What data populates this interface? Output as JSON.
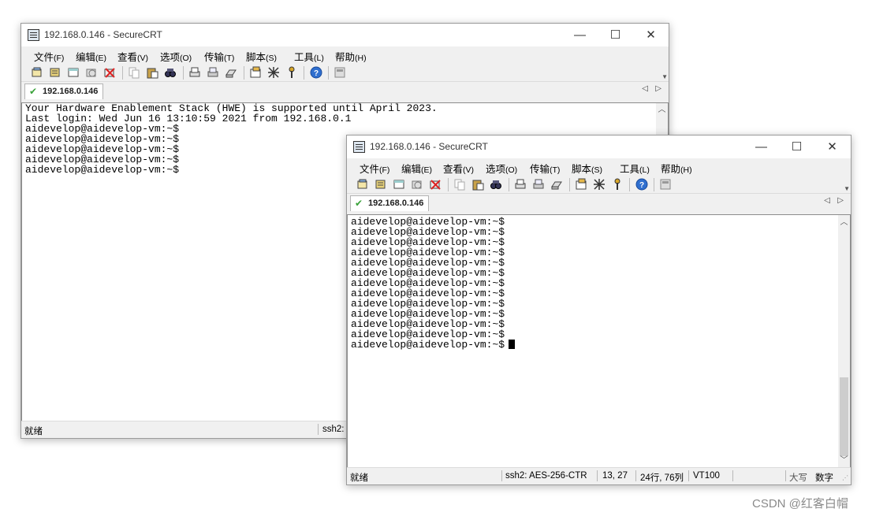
{
  "back_window": {
    "title": "192.168.0.146 - SecureCRT",
    "tab_label": "192.168.0.146",
    "terminal_lines": [
      "Your Hardware Enablement Stack (HWE) is supported until April 2023.",
      "Last login: Wed Jun 16 13:10:59 2021 from 192.168.0.1",
      "aidevelop@aidevelop-vm:~$",
      "aidevelop@aidevelop-vm:~$",
      "aidevelop@aidevelop-vm:~$",
      "aidevelop@aidevelop-vm:~$",
      "aidevelop@aidevelop-vm:~$"
    ],
    "status_ready": "就绪",
    "status_ssh": "ssh2:"
  },
  "front_window": {
    "title": "192.168.0.146 - SecureCRT",
    "tab_label": "192.168.0.146",
    "terminal_lines": [
      "aidevelop@aidevelop-vm:~$",
      "aidevelop@aidevelop-vm:~$",
      "aidevelop@aidevelop-vm:~$",
      "aidevelop@aidevelop-vm:~$",
      "aidevelop@aidevelop-vm:~$",
      "aidevelop@aidevelop-vm:~$",
      "aidevelop@aidevelop-vm:~$",
      "aidevelop@aidevelop-vm:~$",
      "aidevelop@aidevelop-vm:~$",
      "aidevelop@aidevelop-vm:~$",
      "aidevelop@aidevelop-vm:~$",
      "aidevelop@aidevelop-vm:~$",
      "aidevelop@aidevelop-vm:~$"
    ],
    "status": {
      "ready": "就绪",
      "cipher": "ssh2: AES-256-CTR",
      "cursor_pos": "13, 27",
      "size": "24行, 76列",
      "emulation": "VT100",
      "caps": "大写",
      "num": "数字"
    }
  },
  "menu": [
    {
      "label": "文件",
      "accel": "(F)"
    },
    {
      "label": "编辑",
      "accel": "(E)"
    },
    {
      "label": "查看",
      "accel": "(V)"
    },
    {
      "label": "选项",
      "accel": "(O)"
    },
    {
      "label": "传输",
      "accel": "(T)"
    },
    {
      "label": "脚本",
      "accel": "(S)"
    },
    {
      "label": "工具",
      "accel": "(L)"
    },
    {
      "label": "帮助",
      "accel": "(H)"
    }
  ],
  "window_buttons": {
    "minimize": "—",
    "maximize": "☐",
    "close": "✕"
  },
  "watermark": "CSDN @红客白帽"
}
